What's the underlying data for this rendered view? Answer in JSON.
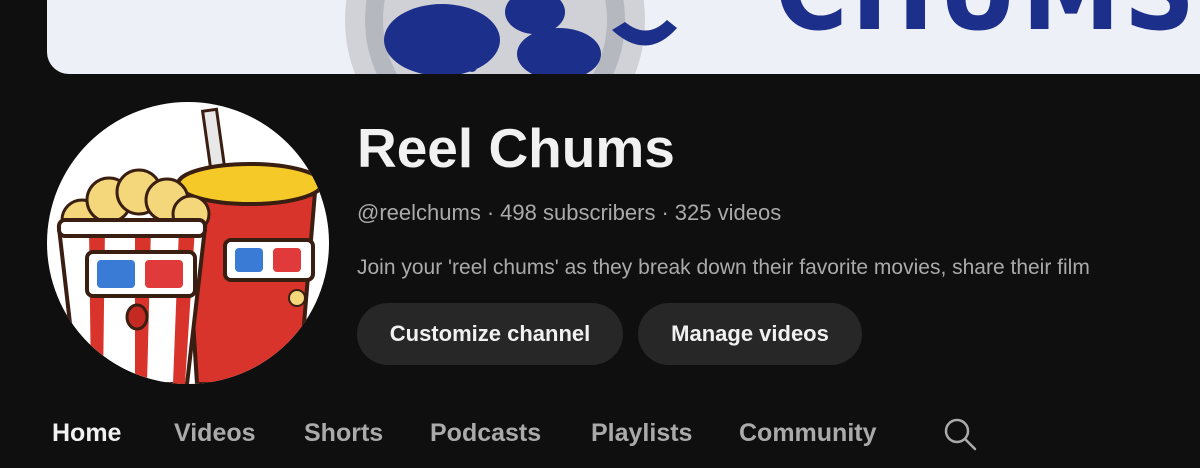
{
  "banner": {
    "text": "CHUMS"
  },
  "channel": {
    "name": "Reel Chums",
    "handle": "@reelchums",
    "subscribers": "498 subscribers",
    "videos": "325 videos",
    "separator": "·",
    "description": "Join your 'reel chums' as they break down their favorite movies, share their film"
  },
  "buttons": {
    "customize": "Customize channel",
    "manage": "Manage videos"
  },
  "tabs": {
    "active": "Home",
    "items": [
      "Home",
      "Videos",
      "Shorts",
      "Podcasts",
      "Playlists",
      "Community"
    ]
  },
  "icons": {
    "avatar": "popcorn-and-soda-cartoon",
    "search": "search-icon"
  },
  "colors": {
    "background": "#0f0f0f",
    "banner": "#eef0f7",
    "banner_accent": "#1c2f8a",
    "button": "#272727",
    "text_primary": "#f1f1f1",
    "text_secondary": "#aaaaaa"
  }
}
